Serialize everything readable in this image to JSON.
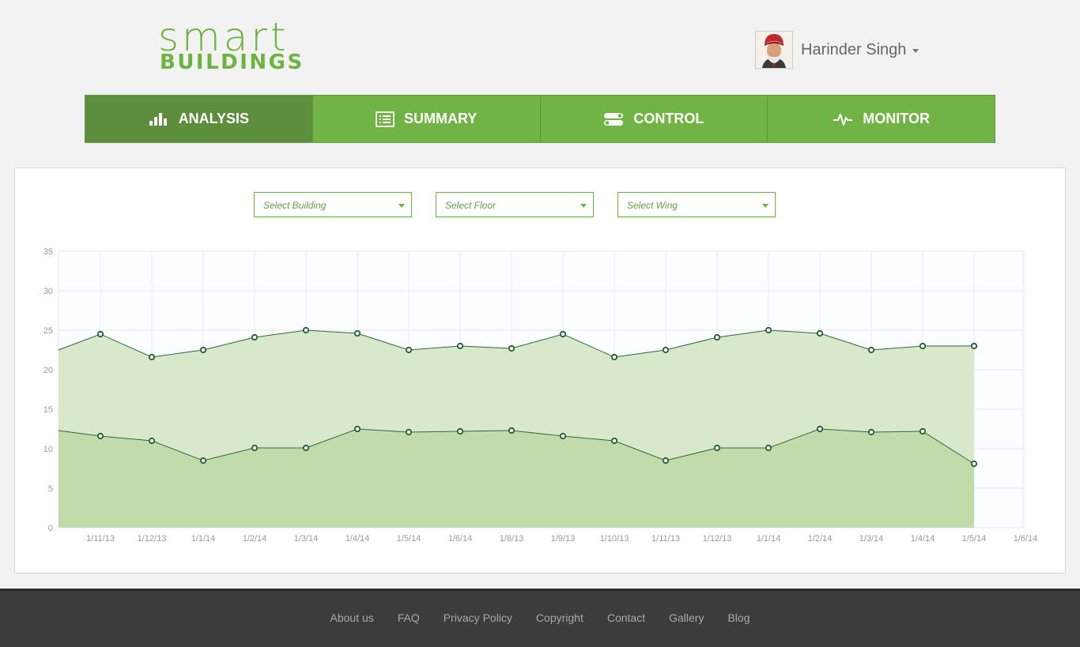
{
  "logo": {
    "top": "smart",
    "bottom": "BUILDINGS"
  },
  "user": {
    "name": "Harinder Singh"
  },
  "nav": {
    "tabs": [
      {
        "label": "ANALYSIS",
        "icon": "bar-chart-icon",
        "active": true
      },
      {
        "label": "SUMMARY",
        "icon": "list-icon",
        "active": false
      },
      {
        "label": "CONTROL",
        "icon": "toggle-icon",
        "active": false
      },
      {
        "label": "MONITOR",
        "icon": "pulse-icon",
        "active": false
      }
    ]
  },
  "filters": {
    "building": "Select Building",
    "floor": "Select Floor",
    "wing": "Select Wing"
  },
  "colors": {
    "accent": "#6cb33f",
    "active_tab": "#5c8e3e",
    "line": "#2a6b3a"
  },
  "chart_data": {
    "type": "area",
    "ylim": [
      0,
      35
    ],
    "yticks": [
      0,
      5,
      10,
      15,
      20,
      25,
      30,
      35
    ],
    "x": [
      "1/11/13",
      "1/12/13",
      "1/1/14",
      "1/2/14",
      "1/3/14",
      "1/4/14",
      "1/5/14",
      "1/6/14",
      "1/8/13",
      "1/9/13",
      "1/10/13",
      "1/11/13",
      "1/12/13",
      "1/1/14",
      "1/2/14",
      "1/3/14",
      "1/4/14",
      "1/5/14",
      "1/6/14"
    ],
    "grid": true,
    "series": [
      {
        "values": [
          22.5,
          24.5,
          21.6,
          22.5,
          24.1,
          25.0,
          24.6,
          22.5,
          23.0,
          22.7,
          24.5,
          21.6,
          22.5,
          24.1,
          25.0,
          24.6,
          22.5,
          23.0,
          23.0
        ]
      },
      {
        "values": [
          12.3,
          11.6,
          11.0,
          8.5,
          10.1,
          10.1,
          12.5,
          12.1,
          12.2,
          12.3,
          11.6,
          11.0,
          8.5,
          10.1,
          10.1,
          12.5,
          12.1,
          12.2,
          8.1
        ]
      }
    ]
  },
  "footer": {
    "links": [
      "About us",
      "FAQ",
      "Privacy Policy",
      "Copyright",
      "Contact",
      "Gallery",
      "Blog"
    ]
  }
}
